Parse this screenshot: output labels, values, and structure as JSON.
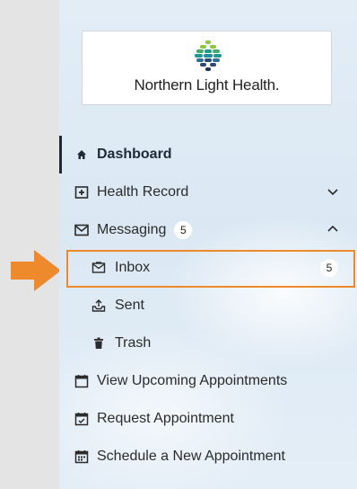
{
  "brand": {
    "name": "Northern Light Health."
  },
  "nav": {
    "dashboard": "Dashboard",
    "health_record": "Health Record",
    "messaging": "Messaging",
    "messaging_badge": "5",
    "inbox": "Inbox",
    "inbox_badge": "5",
    "sent": "Sent",
    "trash": "Trash",
    "view_appointments": "View Upcoming Appointments",
    "request_appointment": "Request Appointment",
    "schedule_appointment": "Schedule a New Appointment"
  },
  "colors": {
    "highlight": "#ef8a2c",
    "active_border": "#1f2a36",
    "logo_teal": "#1f9a8a",
    "logo_green": "#8cc63f",
    "logo_navy": "#2b4a6f"
  }
}
